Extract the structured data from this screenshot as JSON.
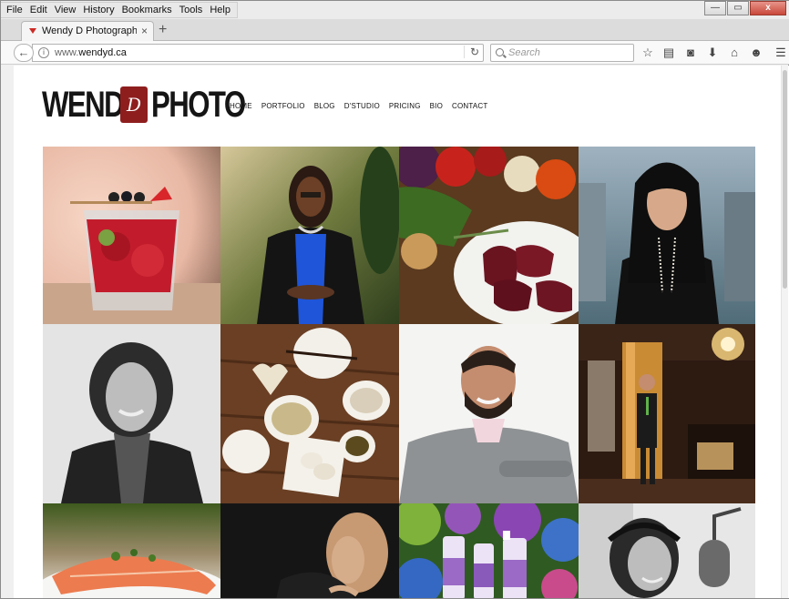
{
  "browser": {
    "menu": [
      "File",
      "Edit",
      "View",
      "History",
      "Bookmarks",
      "Tools",
      "Help"
    ],
    "window_controls": {
      "minimize": "—",
      "maximize": "▭",
      "close": "x"
    },
    "tab": {
      "title": "Wendy D Photography, Ma...",
      "close": "×"
    },
    "new_tab": "+",
    "address": {
      "prefix": "www.",
      "domain": "wendyd.ca"
    },
    "search_placeholder": "Search",
    "toolbar_icons": [
      "star-icon",
      "reading-list-icon",
      "pocket-icon",
      "download-icon",
      "home-icon",
      "chat-icon",
      "menu-icon"
    ]
  },
  "site": {
    "logo": {
      "word1": "WENDY",
      "badge": "D",
      "word2": "PHOTO",
      "badge_color": "#8e1e1e"
    },
    "nav": [
      "HOME",
      "PORTFOLIO",
      "BLOG",
      "D'STUDIO",
      "PRICING",
      "BIO",
      "CONTACT"
    ],
    "gallery": [
      {
        "name": "cocktail"
      },
      {
        "name": "woman-portrait-blue"
      },
      {
        "name": "steak-vegetables"
      },
      {
        "name": "woman-portrait-city"
      },
      {
        "name": "woman-portrait-bw"
      },
      {
        "name": "desserts-table"
      },
      {
        "name": "man-portrait-sweater"
      },
      {
        "name": "restaurant-interior"
      },
      {
        "name": "salmon-dish"
      },
      {
        "name": "woman-portrait-dark"
      },
      {
        "name": "product-flowers"
      },
      {
        "name": "woman-microphone-bw"
      }
    ]
  }
}
